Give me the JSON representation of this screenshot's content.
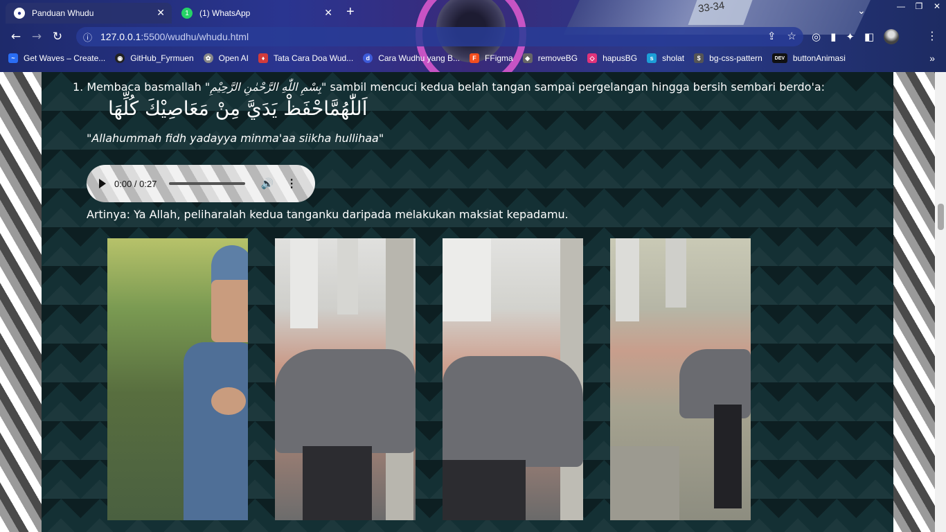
{
  "browser": {
    "tabs": [
      {
        "title": "Panduan Whudu",
        "active": true
      },
      {
        "title": "(1) WhatsApp",
        "active": false
      }
    ],
    "new_tab": "+",
    "decor_text": "33-34",
    "address": {
      "host": "127.0.0.1",
      "path": ":5500/wudhu/whudu.html"
    },
    "bookmarks": [
      {
        "label": "Get Waves – Create...",
        "icon": "waves-icon",
        "color": "#2a6df4"
      },
      {
        "label": "GitHub_Fyrmuen",
        "icon": "github-icon",
        "color": "#222222"
      },
      {
        "label": "Open AI",
        "icon": "openai-icon",
        "color": "#888888"
      },
      {
        "label": "Tata Cara Doa Wud...",
        "icon": "site-icon",
        "color": "#d23b3b"
      },
      {
        "label": "Cara Wudhu yang B...",
        "icon": "d-icon",
        "color": "#3d5bd8"
      },
      {
        "label": "FFigma",
        "icon": "figma-icon",
        "color": "#f24e1e"
      },
      {
        "label": "removeBG",
        "icon": "layers-icon",
        "color": "#666666"
      },
      {
        "label": "hapusBG",
        "icon": "diamond-icon",
        "color": "#e0337a"
      },
      {
        "label": "sholat",
        "icon": "s-icon",
        "color": "#1c9fd8"
      },
      {
        "label": "bg-css-pattern",
        "icon": "pattern-icon",
        "color": "#555555"
      },
      {
        "label": "buttonAnimasi",
        "icon": "dev-icon",
        "color": "#111111"
      }
    ]
  },
  "page": {
    "step_prefix": "1. Membaca basmallah \"",
    "basmallah": "بِسْمِ اللّٰهِ الرَّحْمٰنِ الرَّحِيْمِ",
    "step_suffix": "\" sambil mencuci kedua belah tangan sampai pergelangan hingga bersih sembari berdo'a:",
    "doa_arabic": "اَللّٰهُمَّاحْفَظْ يَدَيَّ مِنْ مَعَاصِيْكَ كُلِّهَا",
    "doa_latin": "\"Allahummah fidh yadayya minma'aa siikha hullihaa\"",
    "audio_time": "0:00 / 0:27",
    "meaning": "Artinya: Ya Allah, peliharalah kedua tanganku daripada melakukan maksiat kepadamu."
  }
}
